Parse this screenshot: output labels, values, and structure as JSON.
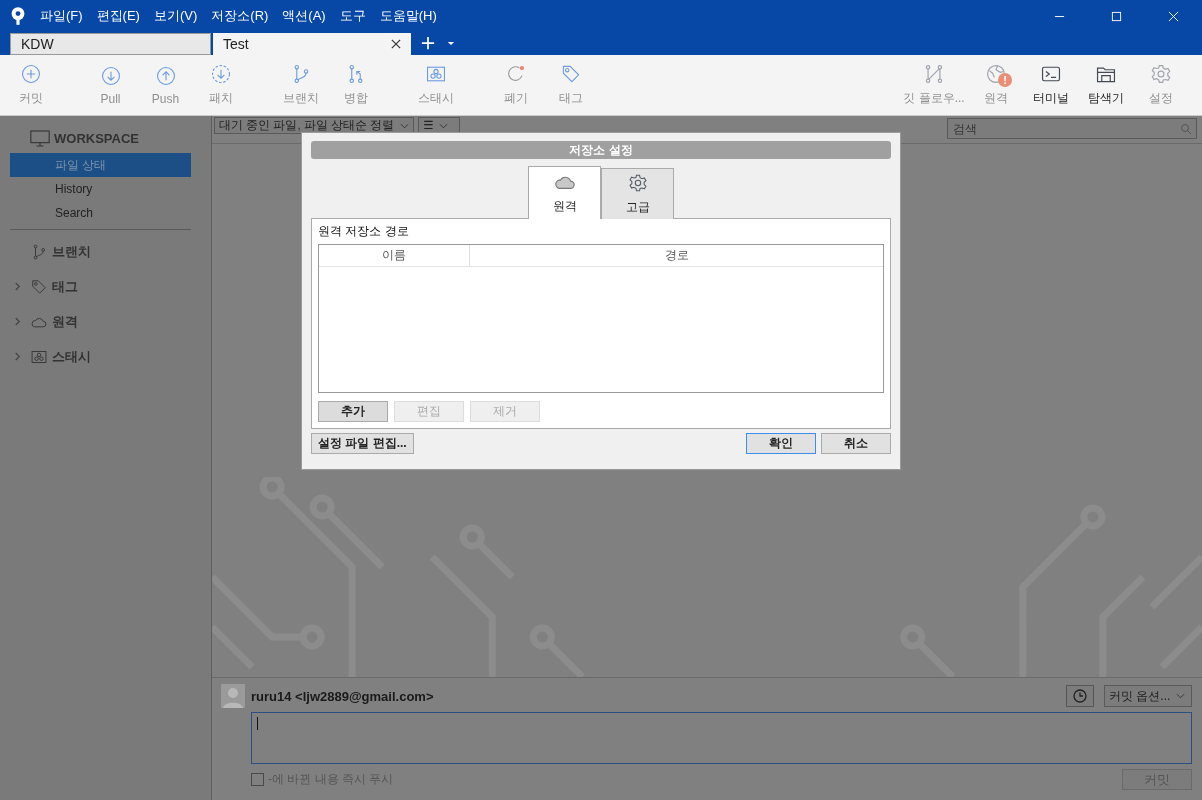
{
  "menu": [
    "파일(F)",
    "편집(E)",
    "보기(V)",
    "저장소(R)",
    "액션(A)",
    "도구",
    "도움말(H)"
  ],
  "repo_tabs": [
    {
      "label": "KDW",
      "selected": false
    },
    {
      "label": "Test",
      "selected": true
    }
  ],
  "toolbar": {
    "left": [
      {
        "label": "커밋",
        "dimmed": true
      },
      {
        "label": "Pull",
        "dimmed": true
      },
      {
        "label": "Push",
        "dimmed": true
      },
      {
        "label": "패치",
        "dimmed": true
      },
      {
        "label": "브랜치",
        "dimmed": true
      },
      {
        "label": "병합",
        "dimmed": true
      },
      {
        "label": "스태시",
        "dimmed": true
      },
      {
        "label": "폐기",
        "dimmed": true
      },
      {
        "label": "태그",
        "dimmed": true
      }
    ],
    "right": [
      {
        "label": "깃 플로우...",
        "dimmed": true
      },
      {
        "label": "원격",
        "dimmed": true,
        "badge": "!"
      },
      {
        "label": "터미널",
        "dimmed": false
      },
      {
        "label": "탐색기",
        "dimmed": false
      },
      {
        "label": "설정",
        "dimmed": true
      }
    ]
  },
  "sidebar": {
    "workspace": {
      "title": "WORKSPACE",
      "items": [
        {
          "label": "파일 상태",
          "selected": true
        },
        {
          "label": "History",
          "selected": false
        },
        {
          "label": "Search",
          "selected": false
        }
      ]
    },
    "sections": [
      {
        "label": "브랜치"
      },
      {
        "label": "태그",
        "expanded": false
      },
      {
        "label": "원격",
        "expanded": false
      },
      {
        "label": "스태시",
        "expanded": false
      }
    ]
  },
  "filter_bar": {
    "file_filter": "대기 중인 파일, 파일 상태순 정렬",
    "view_menu": "☰",
    "search": {
      "placeholder": "검색"
    }
  },
  "commit_area": {
    "author": "ruru14 <ljw2889@gmail.com>",
    "options": "커밋 옵션...",
    "push_checkbox": {
      "label": "-에 바뀐 내용 즉시 푸시",
      "checked": false
    },
    "commit_button": {
      "label": "커밋",
      "disabled": true
    }
  },
  "dialog": {
    "title": "저장소 설정",
    "tabs": [
      {
        "label": "원격",
        "selected": true
      },
      {
        "label": "고급",
        "selected": false
      }
    ],
    "group_label": "원격 저장소 경로",
    "columns": [
      "이름",
      "경로"
    ],
    "buttons": [
      {
        "label": "추가",
        "disabled": false
      },
      {
        "label": "편집",
        "disabled": true
      },
      {
        "label": "제거",
        "disabled": true
      }
    ],
    "footer": {
      "edit_config": "설정 파일 편집...",
      "ok": "확인",
      "cancel": "취소"
    }
  }
}
